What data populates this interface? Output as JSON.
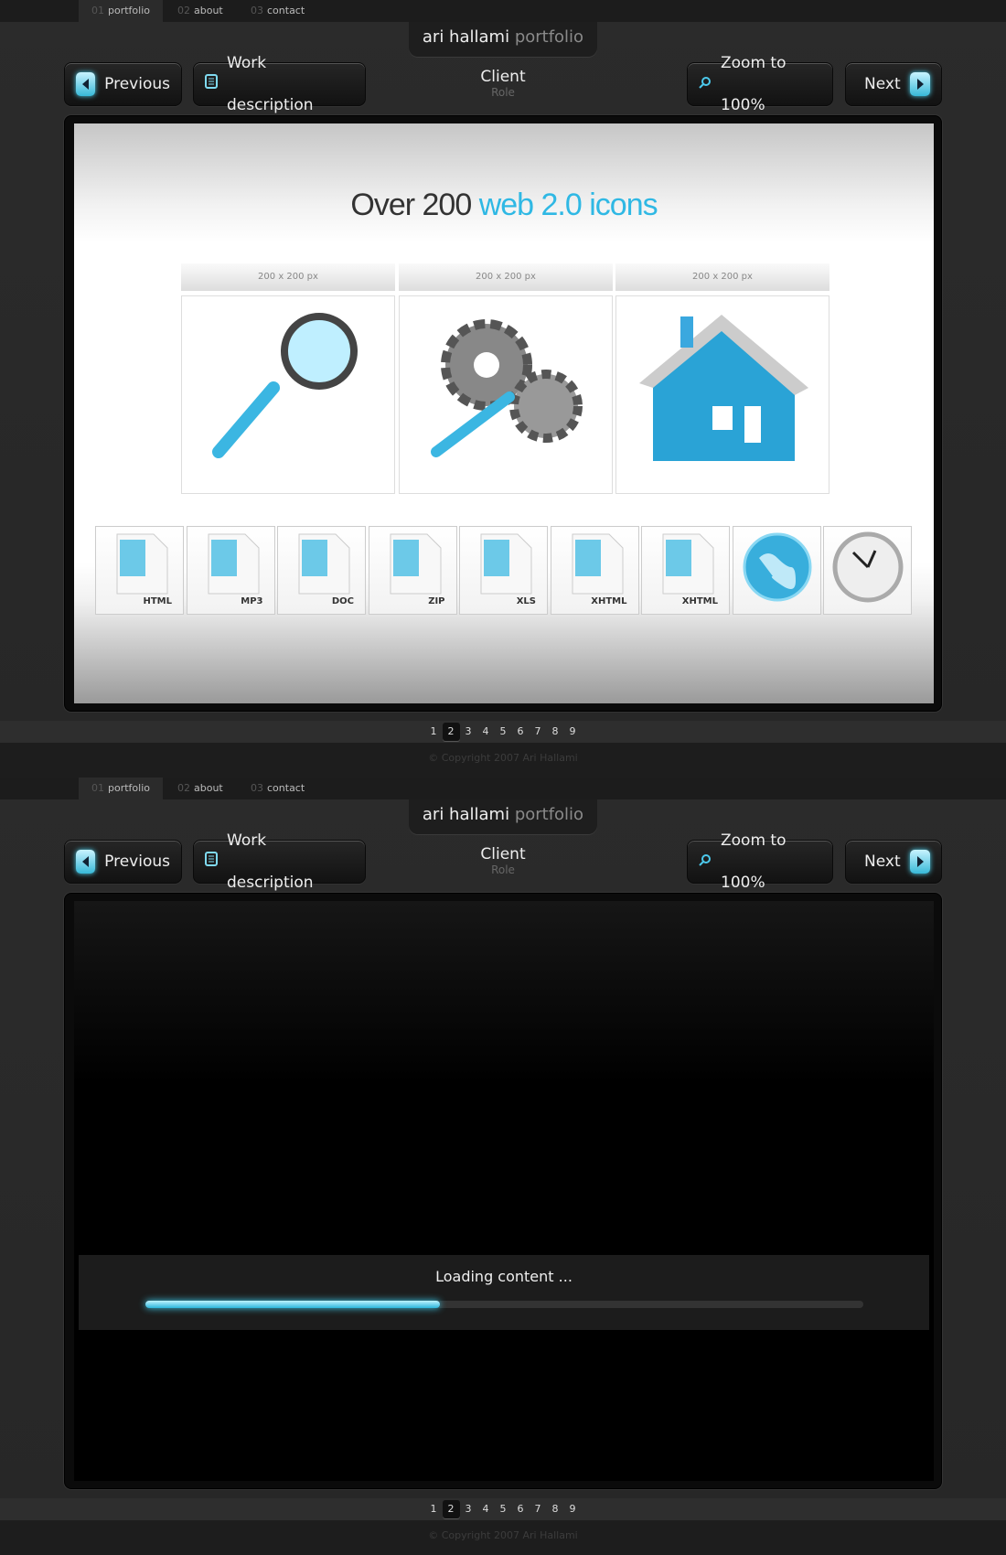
{
  "nav": [
    {
      "num": "01",
      "label": "portfolio"
    },
    {
      "num": "02",
      "label": "about"
    },
    {
      "num": "03",
      "label": "contact"
    }
  ],
  "title": {
    "name": "ari hallami",
    "suffix": "portfolio"
  },
  "buttons": {
    "previous": "Previous",
    "work_description": "Work description",
    "zoom": "Zoom to 100%",
    "next": "Next"
  },
  "project": {
    "client": "Client",
    "role": "Role"
  },
  "pagination": {
    "pages": [
      "1",
      "2",
      "3",
      "4",
      "5",
      "6",
      "7",
      "8",
      "9"
    ],
    "current": "2"
  },
  "copyright": "© Copyright 2007 Ari Hallami",
  "slide": {
    "headline_a": "Over 200",
    "headline_b": "web 2.0 icons",
    "size_labels": [
      "200 x 200 px",
      "200 x 200 px",
      "200 x 200 px"
    ],
    "big_icons": [
      "magnifier-icon",
      "gears-wrench-icon",
      "house-icon"
    ],
    "small_icons": [
      {
        "icon": "book-icon",
        "label": "HTML"
      },
      {
        "icon": "music-file-icon",
        "label": "MP3"
      },
      {
        "icon": "doc-file-icon",
        "label": "DOC"
      },
      {
        "icon": "zip-file-icon",
        "label": "ZIP"
      },
      {
        "icon": "xls-file-icon",
        "label": "XLS"
      },
      {
        "icon": "table-file-icon",
        "label": "XHTML"
      },
      {
        "icon": "book-file-icon",
        "label": "XHTML"
      },
      {
        "icon": "globe-icon",
        "label": ""
      },
      {
        "icon": "clock-icon",
        "label": ""
      }
    ]
  },
  "loading": {
    "text": "Loading content ...",
    "progress_percent": 41
  },
  "colors": {
    "accent": "#2fb8e4",
    "background": "#2a2a2a"
  }
}
